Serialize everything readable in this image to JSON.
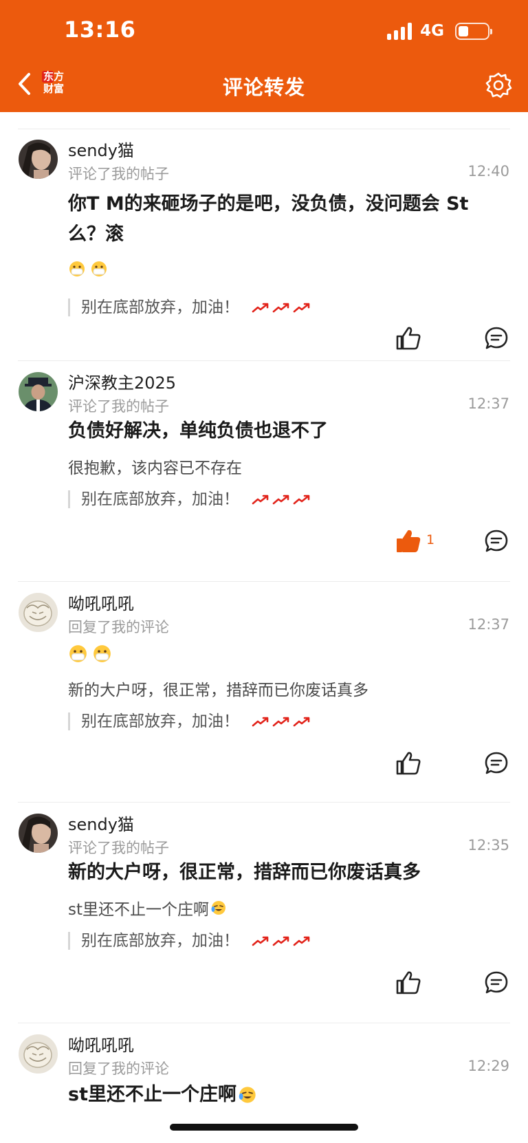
{
  "status_bar": {
    "time": "13:16",
    "network": "4G"
  },
  "nav": {
    "logo_line1": "东方",
    "logo_line2": "财富",
    "title": "评论转发"
  },
  "comments": [
    {
      "user": "sendy猫",
      "action": "评论了我的帖子",
      "time": "12:40",
      "content": "你T M的来砸场子的是吧，没负债，没问题会 St么？滚",
      "quote": "别在底部放弃，加油！",
      "liked": false,
      "like_count": ""
    },
    {
      "user": "沪深教主2025",
      "action": "评论了我的帖子",
      "time": "12:37",
      "content": "负债好解决，单纯负债也退不了",
      "sub": "很抱歉，该内容已不存在",
      "quote": "别在底部放弃，加油！",
      "liked": true,
      "like_count": "1"
    },
    {
      "user": "呦吼吼吼",
      "action": "回复了我的评论",
      "time": "12:37",
      "sub": "新的大户呀，很正常，措辞而已你废话真多",
      "quote": "别在底部放弃，加油！",
      "liked": false,
      "like_count": ""
    },
    {
      "user": "sendy猫",
      "action": "评论了我的帖子",
      "time": "12:35",
      "content": "新的大户呀，很正常，措辞而已你废话真多",
      "sub": "st里还不止一个庄啊",
      "quote": "别在底部放弃，加油！",
      "liked": false,
      "like_count": ""
    },
    {
      "user": "呦吼吼吼",
      "action": "回复了我的评论",
      "time": "12:29",
      "content": "st里还不止一个庄啊"
    }
  ],
  "colors": {
    "brand": "#ec5a0d",
    "like_active": "#ec5a0d",
    "arrow": "#e2231a"
  },
  "icons": [
    "back-icon",
    "settings-icon",
    "like-icon",
    "comment-icon",
    "mask-emoji",
    "stock-up-arrow-icon",
    "laugh-cry-emoji"
  ]
}
